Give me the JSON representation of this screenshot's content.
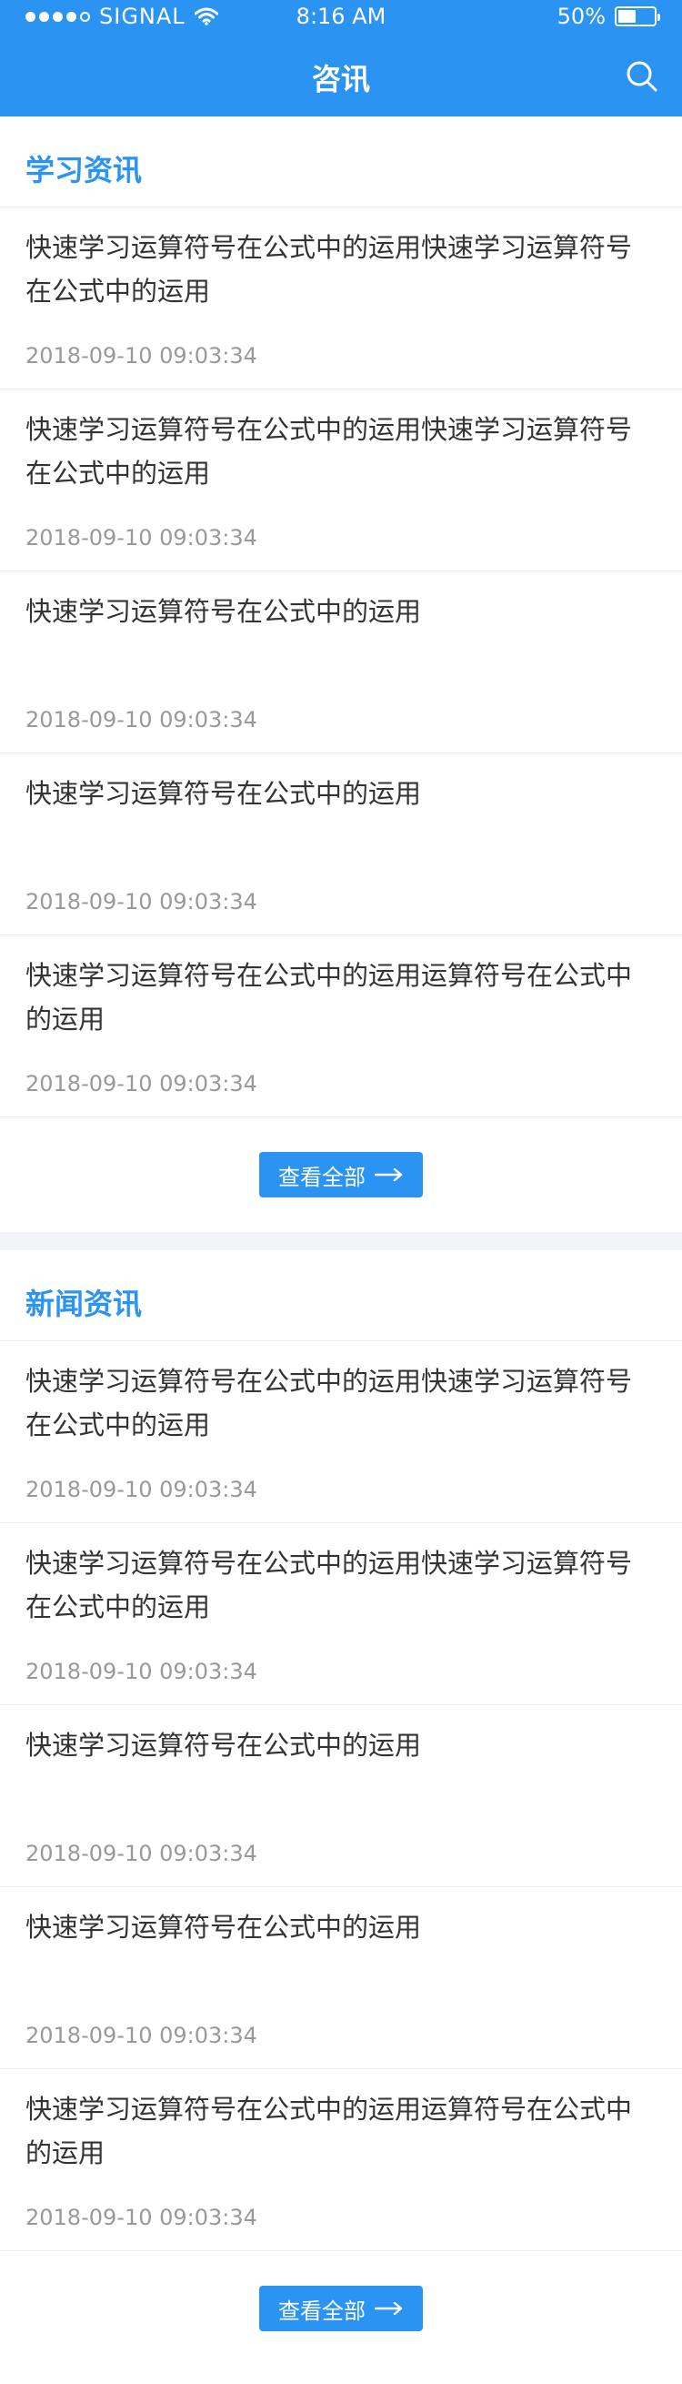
{
  "status_bar": {
    "carrier": "SIGNAL",
    "time": "8:16 AM",
    "battery_text": "50%",
    "battery_level": 0.5
  },
  "header": {
    "title": "咨讯",
    "search_icon": "search-icon"
  },
  "sections": [
    {
      "title": "学习资讯",
      "items": [
        {
          "title": "快速学习运算符号在公式中的运用快速学习运算符号在公式中的运用",
          "date": "2018-09-10  09:03:34"
        },
        {
          "title": "快速学习运算符号在公式中的运用快速学习运算符号在公式中的运用",
          "date": "2018-09-10  09:03:34"
        },
        {
          "title": "快速学习运算符号在公式中的运用",
          "date": "2018-09-10  09:03:34"
        },
        {
          "title": "快速学习运算符号在公式中的运用",
          "date": "2018-09-10  09:03:34"
        },
        {
          "title": "快速学习运算符号在公式中的运用运算符号在公式中的运用",
          "date": "2018-09-10  09:03:34"
        }
      ],
      "more_label": "查看全部"
    },
    {
      "title": "新闻资讯",
      "items": [
        {
          "title": "快速学习运算符号在公式中的运用快速学习运算符号在公式中的运用",
          "date": "2018-09-10  09:03:34"
        },
        {
          "title": "快速学习运算符号在公式中的运用快速学习运算符号在公式中的运用",
          "date": "2018-09-10  09:03:34"
        },
        {
          "title": "快速学习运算符号在公式中的运用",
          "date": "2018-09-10  09:03:34"
        },
        {
          "title": "快速学习运算符号在公式中的运用",
          "date": "2018-09-10  09:03:34"
        },
        {
          "title": "快速学习运算符号在公式中的运用运算符号在公式中的运用",
          "date": "2018-09-10  09:03:34"
        }
      ],
      "more_label": "查看全部"
    }
  ],
  "colors": {
    "accent": "#2b94f3",
    "title_text": "#333333",
    "date_text": "#999999",
    "divider": "#ececec",
    "band": "#f2f3f7"
  }
}
